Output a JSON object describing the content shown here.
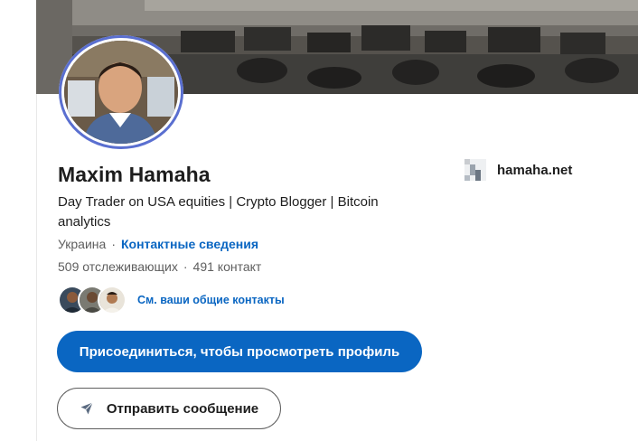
{
  "profile": {
    "name": "Maxim Hamaha",
    "headline": "Day Trader on USA equities | Crypto Blogger | Bitcoin analytics",
    "location": "Украина",
    "separator": "·",
    "contact_info_label": "Контактные сведения",
    "followers": "509 отслеживающих",
    "connections": "491 контакт",
    "mutual_label": "См. ваши общие контакты",
    "website": "hamaha.net"
  },
  "actions": {
    "join_label": "Присоединиться, чтобы просмотреть профиль",
    "message_label": "Отправить сообщение"
  },
  "icons": {
    "message": "send-icon",
    "website": "website-favicon-icon"
  },
  "colors": {
    "brand_blue": "#0a66c2",
    "avatar_ring": "#5a6fd0",
    "text_primary": "#1d1d1d",
    "text_secondary": "#5e5e5e"
  }
}
